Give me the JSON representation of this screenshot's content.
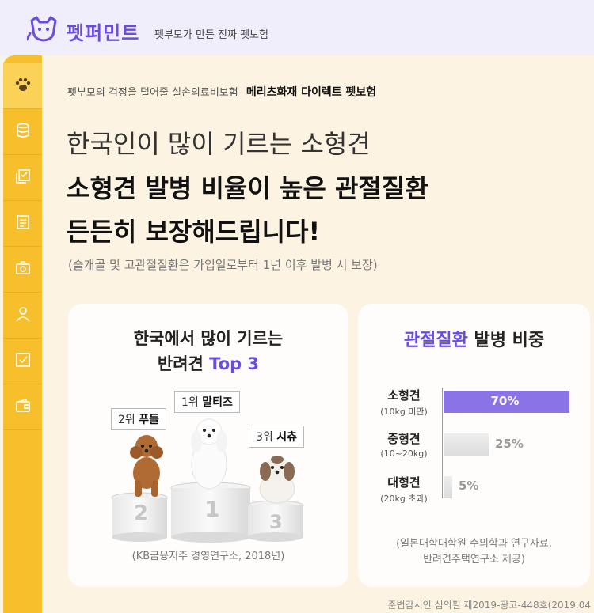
{
  "header": {
    "brand": "펫퍼민트",
    "tagline": "펫부모가 만든 진짜 펫보험"
  },
  "sidebar": {
    "items": [
      {
        "icon": "paw-icon"
      },
      {
        "icon": "database-icon"
      },
      {
        "icon": "checklist-icon"
      },
      {
        "icon": "document-icon"
      },
      {
        "icon": "camera-icon"
      },
      {
        "icon": "person-icon"
      },
      {
        "icon": "checkbox-icon"
      },
      {
        "icon": "wallet-icon"
      }
    ]
  },
  "banner": {
    "subtitle": "펫부모의 걱정을 덜어줄 실손의료비보험",
    "subtitle_bold": "메리츠화재 다이렉트 펫보험",
    "line1": "한국인이 많이 기르는 소형견",
    "line2": "소형견 발병 비율이 높은 관절질환",
    "line3": "든든히 보장해드립니다!",
    "note": "(슬개골 및 고관절질환은 가입일로부터 1년 이후 발병 시 보장)"
  },
  "left_card": {
    "title_line1": "한국에서 많이 기르는",
    "title_line2_prefix": "반려견 ",
    "title_line2_highlight": "Top 3",
    "rank1": {
      "rank": "1위",
      "name": "말티즈",
      "number": "1"
    },
    "rank2": {
      "rank": "2위",
      "name": "푸들",
      "number": "2"
    },
    "rank3": {
      "rank": "3위",
      "name": "시츄",
      "number": "3"
    },
    "source": "(KB금융지주 경영연구소, 2018년)"
  },
  "right_card": {
    "title_highlight": "관절질환",
    "title_rest": " 발병 비중",
    "source_line1": "(일본대학대학원 수의학과 연구자료,",
    "source_line2": "반려견주택연구소 제공)"
  },
  "chart_data": {
    "type": "bar",
    "orientation": "horizontal",
    "categories": [
      "소형견",
      "중형견",
      "대형견"
    ],
    "category_sublabels": [
      "(10kg 미만)",
      "(10~20kg)",
      "(20kg 초과)"
    ],
    "values": [
      70,
      25,
      5
    ],
    "value_labels": [
      "70%",
      "25%",
      "5%"
    ],
    "xlim": [
      0,
      70
    ],
    "colors": {
      "highlight": "#8a73e6",
      "default": "#dcdcdc"
    }
  },
  "footer": {
    "compliance": "준법감시인 심의필 제2019-광고-448호(2019.04"
  }
}
